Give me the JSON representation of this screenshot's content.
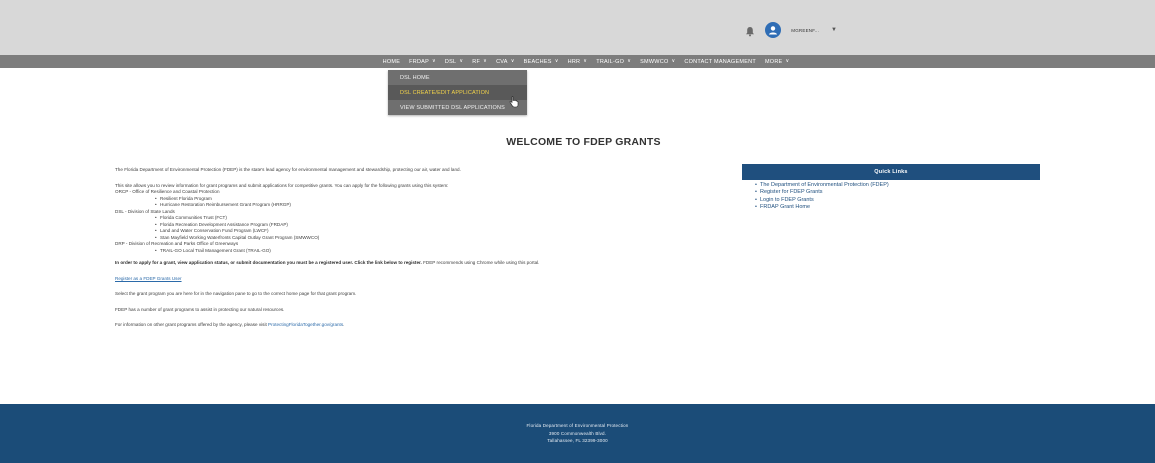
{
  "header": {
    "username": "MGREENF...",
    "colors": {
      "topbar": "#d8d8d8",
      "navbar": "#7d7d7d",
      "avatar": "#2f6db5"
    }
  },
  "nav": {
    "items": [
      {
        "label": "HOME",
        "dropdown": false
      },
      {
        "label": "FRDAP",
        "dropdown": true
      },
      {
        "label": "DSL",
        "dropdown": true
      },
      {
        "label": "RF",
        "dropdown": true
      },
      {
        "label": "CVA",
        "dropdown": true
      },
      {
        "label": "BEACHES",
        "dropdown": true
      },
      {
        "label": "HRR",
        "dropdown": true
      },
      {
        "label": "TRAIL-GO",
        "dropdown": true
      },
      {
        "label": "SMWWCO",
        "dropdown": true
      },
      {
        "label": "CONTACT MANAGEMENT",
        "dropdown": false
      },
      {
        "label": "MORE",
        "dropdown": true
      }
    ]
  },
  "dropdown": {
    "items": [
      {
        "label": "DSL HOME"
      },
      {
        "label": "DSL CREATE/EDIT APPLICATION"
      },
      {
        "label": "VIEW SUBMITTED DSL APPLICATIONS"
      }
    ],
    "highlight_color": "#f4d54a"
  },
  "main": {
    "title": "WELCOME TO FDEP GRANTS",
    "intro": "The Florida Department of Environmental Protection (FDEP) is the state's lead agency for environmental management and stewardship, protecting our air, water and land.",
    "allows": "This site allows you to review information for grant programs and submit applications for competitive grants. You can apply for the following grants using this system:",
    "orcp": "ORCP - Office of Resilience and Coastal Protection",
    "orcp_items": [
      "Resilient Florida Program",
      "Hurricane Restoration Reimbursement Grant Program (HRRGP)"
    ],
    "dsl": "DSL - Division of State Lands",
    "dsl_items": [
      "Florida Communities Trust (FCT)",
      "Florida Recreation Development Assistance Program (FRDAP)",
      "Land and Water Conservation Fund Program (LWCF)",
      "Stan Mayfield Working Waterfronts Capital Outlay Grant Program (SMWWCO)"
    ],
    "drp": "DRP - Division of Recreation and Parks Office of Greenways",
    "drp_items": [
      "TRAIL-GO Local Trail Management Grant (TRAIL-GO)"
    ],
    "register_note_bold": "In order to apply for a grant, view application status, or submit documentation you must be a registered user. Click the link below to register.",
    "register_note_rest": " FDEP recommends using Chrome while using this portal.",
    "register_link": "Register as a FDEP Grants User",
    "select_text": "Select the grant program you are here for in the navigation pane to go to the correct home page for that grant program.",
    "assist_text": "FDEP has a number of grant programs to assist in protecting our natural resources.",
    "other_text": "For information on other grant programs offered by the agency, please visit ",
    "other_link": "ProtectingFloridaTogether.gov/grants",
    "other_end": "."
  },
  "quick_links": {
    "title": "Quick Links",
    "items": [
      {
        "label": "The Department of Environmental Protection (FDEP)"
      },
      {
        "label": "Register for FDEP Grants"
      },
      {
        "label": "Login to FDEP Grants"
      },
      {
        "label": "FRDAP Grant Home"
      }
    ],
    "header_color": "#1f4f7e"
  },
  "footer": {
    "line1": "Florida Department of Environmental Protection",
    "line2": "3900 Commonwealth Blvd.",
    "line3": "Tallahassee, FL 32399-3000",
    "color": "#1b4c78"
  }
}
